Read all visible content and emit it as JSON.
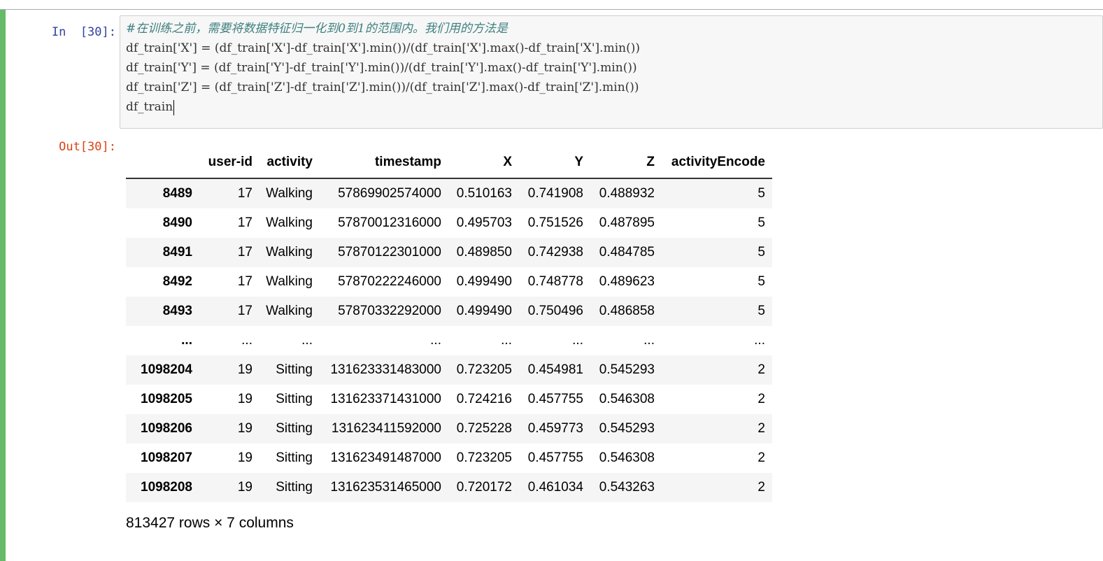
{
  "notebook": {
    "input_prompt": "In  [30]:",
    "output_prompt": "Out[30]:",
    "code_lines": [
      "#在训练之前，需要将数据特征归一化到0到1的范围内。我们用的方法是",
      "df_train['X'] = (df_train['X']-df_train['X'].min())/(df_train['X'].max()-df_train['X'].min())",
      "df_train['Y'] = (df_train['Y']-df_train['Y'].min())/(df_train['Y'].max()-df_train['Y'].min())",
      "df_train['Z'] = (df_train['Z']-df_train['Z'].min())/(df_train['Z'].max()-df_train['Z'].min())",
      "df_train"
    ]
  },
  "table": {
    "columns": [
      "",
      "user-id",
      "activity",
      "timestamp",
      "X",
      "Y",
      "Z",
      "activityEncode"
    ],
    "rows": [
      [
        "8489",
        "17",
        "Walking",
        "57869902574000",
        "0.510163",
        "0.741908",
        "0.488932",
        "5"
      ],
      [
        "8490",
        "17",
        "Walking",
        "57870012316000",
        "0.495703",
        "0.751526",
        "0.487895",
        "5"
      ],
      [
        "8491",
        "17",
        "Walking",
        "57870122301000",
        "0.489850",
        "0.742938",
        "0.484785",
        "5"
      ],
      [
        "8492",
        "17",
        "Walking",
        "57870222246000",
        "0.499490",
        "0.748778",
        "0.489623",
        "5"
      ],
      [
        "8493",
        "17",
        "Walking",
        "57870332292000",
        "0.499490",
        "0.750496",
        "0.486858",
        "5"
      ],
      [
        "...",
        "...",
        "...",
        "...",
        "...",
        "...",
        "...",
        "..."
      ],
      [
        "1098204",
        "19",
        "Sitting",
        "131623331483000",
        "0.723205",
        "0.454981",
        "0.545293",
        "2"
      ],
      [
        "1098205",
        "19",
        "Sitting",
        "131623371431000",
        "0.724216",
        "0.457755",
        "0.546308",
        "2"
      ],
      [
        "1098206",
        "19",
        "Sitting",
        "131623411592000",
        "0.725228",
        "0.459773",
        "0.545293",
        "2"
      ],
      [
        "1098207",
        "19",
        "Sitting",
        "131623491487000",
        "0.723205",
        "0.457755",
        "0.546308",
        "2"
      ],
      [
        "1098208",
        "19",
        "Sitting",
        "131623531465000",
        "0.720172",
        "0.461034",
        "0.543263",
        "2"
      ]
    ],
    "caption": "813427 rows × 7 columns"
  },
  "colors": {
    "cell_border": "#66bb6a",
    "input_prompt": "#303f9f",
    "output_prompt": "#d84315",
    "comment": "#408080"
  }
}
